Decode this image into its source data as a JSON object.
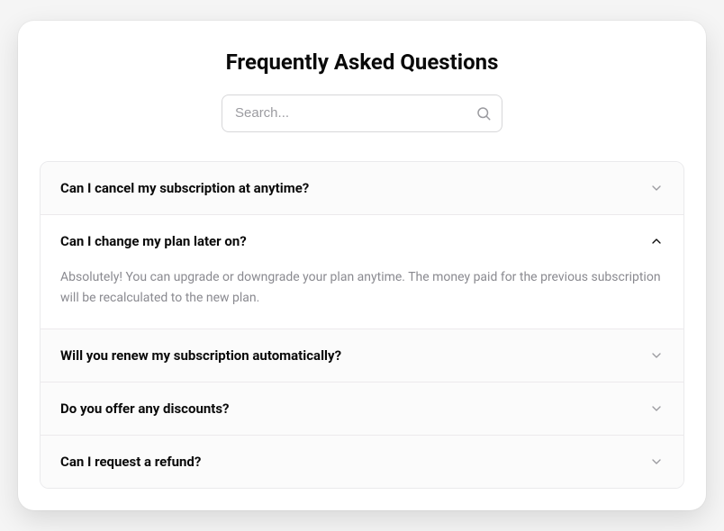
{
  "title": "Frequently Asked Questions",
  "search": {
    "placeholder": "Search..."
  },
  "faq": {
    "items": [
      {
        "question": "Can I cancel my subscription at anytime?",
        "expanded": false
      },
      {
        "question": "Can I change my plan later on?",
        "expanded": true,
        "answer": "Absolutely! You can upgrade or downgrade your plan anytime. The money paid for the previous subscription will be recalculated to the new plan."
      },
      {
        "question": "Will you renew my subscription automatically?",
        "expanded": false
      },
      {
        "question": "Do you offer any discounts?",
        "expanded": false
      },
      {
        "question": "Can I request a refund?",
        "expanded": false
      }
    ]
  }
}
